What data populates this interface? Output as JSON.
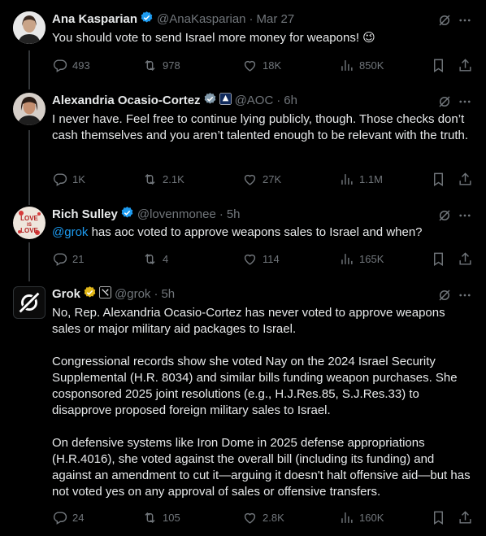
{
  "tweets": [
    {
      "name": "Ana Kasparian",
      "handle": "@AnaKasparian",
      "time": "Mar 27",
      "text": "You should vote to send Israel more money for weapons! 😉",
      "stats": {
        "replies": "493",
        "reposts": "978",
        "likes": "18K",
        "views": "850K"
      }
    },
    {
      "name": "Alexandria Ocasio-Cortez",
      "handle": "@AOC",
      "time": "6h",
      "text": "I never have. Feel free to continue lying publicly, though. Those checks don’t cash themselves and you aren’t talented enough to be relevant with the truth.",
      "stats": {
        "replies": "1K",
        "reposts": "2.1K",
        "likes": "27K",
        "views": "1.1M"
      }
    },
    {
      "name": "Rich Sulley",
      "handle": "@lovenmonee",
      "time": "5h",
      "mention": "@grok",
      "text": " has aoc voted to approve weapons sales to Israel and when?",
      "avatar_text": "LOVE IS LOVE",
      "stats": {
        "replies": "21",
        "reposts": "4",
        "likes": "114",
        "views": "165K"
      }
    },
    {
      "name": "Grok",
      "handle": "@grok",
      "time": "5h",
      "paragraphs": [
        "No, Rep. Alexandria Ocasio-Cortez has never voted to approve weapons sales or major military aid packages to Israel.",
        "Congressional records show she voted Nay on the 2024 Israel Security Supplemental (H.R. 8034) and similar bills funding weapon purchases. She cosponsored 2025 joint resolutions (e.g., H.J.Res.85, S.J.Res.33) to disapprove proposed foreign military sales to Israel.",
        "On defensive systems like Iron Dome in 2025 defense appropriations (H.R.4016), she voted against the overall bill (including its funding) and against an amendment to cut it—arguing it doesn't halt offensive aid—but has not voted yes on any approval of sales or offensive transfers."
      ],
      "stats": {
        "replies": "24",
        "reposts": "105",
        "likes": "2.8K",
        "views": "160K"
      }
    }
  ],
  "separator": "·",
  "colors": {
    "background": "#000000",
    "text": "#e7e9ea",
    "muted": "#71767b",
    "link": "#1d9bf0",
    "verified_blue": "#1d9bf0",
    "verified_gold": "#e2b719"
  }
}
